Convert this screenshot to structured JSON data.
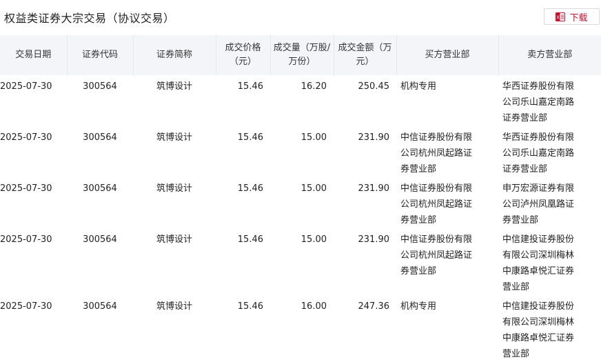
{
  "header": {
    "title": "权益类证券大宗交易（协议交易）",
    "download_label": "下载",
    "download_icon": "file-excel-icon",
    "accent_color": "#c8102e"
  },
  "table": {
    "columns": [
      {
        "key": "date",
        "label": "交易日期"
      },
      {
        "key": "code",
        "label": "证券代码"
      },
      {
        "key": "name",
        "label": "证券简称"
      },
      {
        "key": "price",
        "label": "成交价格（元）"
      },
      {
        "key": "volume",
        "label": "成交量（万股/万份）"
      },
      {
        "key": "amount",
        "label": "成交金额（万元）"
      },
      {
        "key": "buyer",
        "label": "买方营业部"
      },
      {
        "key": "seller",
        "label": "卖方营业部"
      }
    ],
    "rows": [
      {
        "date": "2025-07-30",
        "code": "300564",
        "name": "筑博设计",
        "price": "15.46",
        "volume": "16.20",
        "amount": "250.45",
        "buyer": "机构专用",
        "seller": "华西证券股份有限公司乐山嘉定南路证券营业部"
      },
      {
        "date": "2025-07-30",
        "code": "300564",
        "name": "筑博设计",
        "price": "15.46",
        "volume": "15.00",
        "amount": "231.90",
        "buyer": "中信证券股份有限公司杭州凤起路证券营业部",
        "seller": "华西证券股份有限公司乐山嘉定南路证券营业部"
      },
      {
        "date": "2025-07-30",
        "code": "300564",
        "name": "筑博设计",
        "price": "15.46",
        "volume": "15.00",
        "amount": "231.90",
        "buyer": "中信证券股份有限公司杭州凤起路证券营业部",
        "seller": "申万宏源证券有限公司泸州凤凰路证券营业部"
      },
      {
        "date": "2025-07-30",
        "code": "300564",
        "name": "筑博设计",
        "price": "15.46",
        "volume": "15.00",
        "amount": "231.90",
        "buyer": "中信证券股份有限公司杭州凤起路证券营业部",
        "seller": "中信建投证券股份有限公司深圳梅林中康路卓悦汇证券营业部"
      },
      {
        "date": "2025-07-30",
        "code": "300564",
        "name": "筑博设计",
        "price": "15.46",
        "volume": "16.00",
        "amount": "247.36",
        "buyer": "机构专用",
        "seller": "中信建投证券股份有限公司深圳梅林中康路卓悦汇证券营业部"
      }
    ]
  }
}
